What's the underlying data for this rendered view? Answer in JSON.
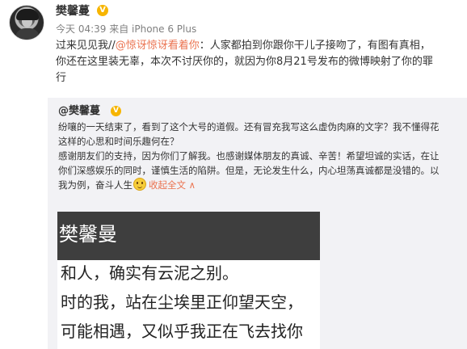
{
  "post": {
    "username": "樊馨蔓",
    "verified_badge": "V",
    "meta": "今天 04:39 来自 iPhone 6 Plus",
    "text_before": "过来见见我//",
    "mention": "@惊讶惊讶看着你",
    "text_line1_rest": "：人家都拍到你跟你干儿子接吻了，有图有真相，",
    "text_line2": "你还在这里装无辜，本次不讨厌你的，就因为你8月21号发布的微博映射了你的罪",
    "text_line3": "行"
  },
  "repost": {
    "username": "@樊馨蔓",
    "verified_badge": "V",
    "line1": "纷嚷的一天结束了，看到了这个大号的道假。还有冒充我写这么虚伪肉麻的文字？我不懂得花",
    "line2": "这样的心思和时间乐趣何在？",
    "line3": "感谢朋友们的支持，因为你们了解我。也感谢媒体朋友的真诚、辛苦！希望坦诚的实话，在让",
    "line4": "你们深感娱乐的同时，谨慎生活的陷阱。但是，无论发生什么，内心坦荡真诚都是没错的。以",
    "line5": "我为例，奋斗人生",
    "collapse_label": "收起全文 ∧",
    "emoji_icon": "smiley-face-icon"
  },
  "image": {
    "title": "樊馨曼",
    "line1": "和人，确实有云泥之别。",
    "line2": "时的我，站在尘埃里正仰望天空，",
    "line3": "可能相遇，又似乎我正在飞去找你"
  }
}
